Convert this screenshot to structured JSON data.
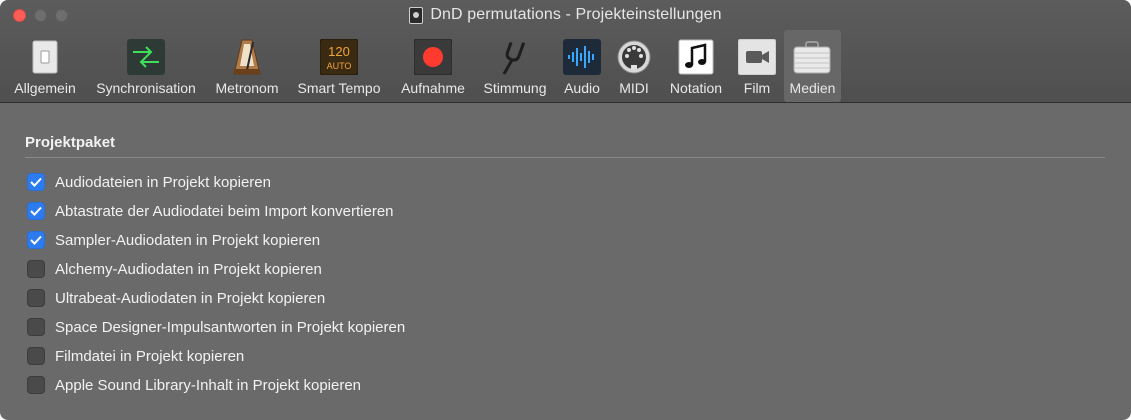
{
  "window": {
    "title": "DnD permutations - Projekteinstellungen"
  },
  "toolbar": {
    "items": [
      {
        "label": "Allgemein",
        "icon": "switch-icon"
      },
      {
        "label": "Synchronisation",
        "icon": "sync-arrows-icon"
      },
      {
        "label": "Metronom",
        "icon": "metronome-icon"
      },
      {
        "label": "Smart Tempo",
        "icon": "tempo-display-icon",
        "display_value": "120",
        "display_sub": "AUTO"
      },
      {
        "label": "Aufnahme",
        "icon": "record-icon"
      },
      {
        "label": "Stimmung",
        "icon": "tuning-fork-icon"
      },
      {
        "label": "Audio",
        "icon": "waveform-icon"
      },
      {
        "label": "MIDI",
        "icon": "midi-connector-icon"
      },
      {
        "label": "Notation",
        "icon": "music-note-icon"
      },
      {
        "label": "Film",
        "icon": "movie-camera-icon"
      },
      {
        "label": "Medien",
        "icon": "briefcase-icon",
        "selected": true
      }
    ]
  },
  "section": {
    "title": "Projektpaket",
    "options": [
      {
        "label": "Audiodateien in Projekt kopieren",
        "checked": true
      },
      {
        "label": "Abtastrate der Audiodatei beim Import konvertieren",
        "checked": true
      },
      {
        "label": "Sampler-Audiodaten in Projekt kopieren",
        "checked": true
      },
      {
        "label": "Alchemy-Audiodaten in Projekt kopieren",
        "checked": false
      },
      {
        "label": "Ultrabeat-Audiodaten in Projekt kopieren",
        "checked": false
      },
      {
        "label": "Space Designer-Impulsantworten in Projekt kopieren",
        "checked": false
      },
      {
        "label": "Filmdatei in Projekt kopieren",
        "checked": false
      },
      {
        "label": "Apple Sound Library-Inhalt in Projekt kopieren",
        "checked": false
      }
    ]
  },
  "colors": {
    "accent": "#2c7cf0",
    "record_red": "#ff3b30",
    "window_bg": "#6a6a6a"
  }
}
